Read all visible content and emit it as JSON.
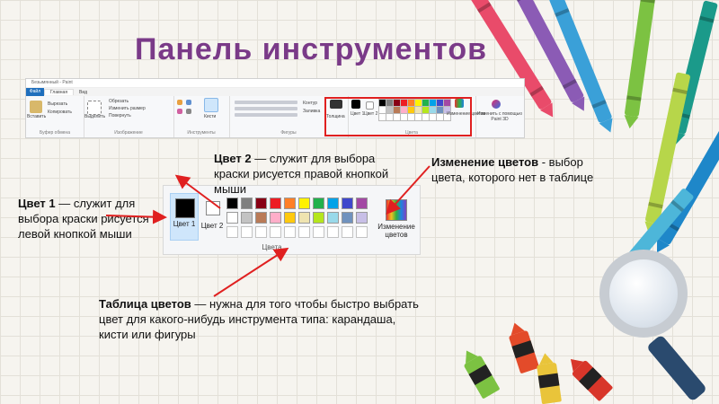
{
  "slide": {
    "title": "Панель инструментов"
  },
  "ribbon": {
    "window_title": "Безымянный - Paint",
    "tabs": [
      "Файл",
      "Главная",
      "Вид"
    ],
    "buttons": {
      "paste": "Вставить",
      "cut": "Вырезать",
      "copy": "Копировать",
      "select": "Выделить",
      "crop": "Обрезать",
      "resize": "Изменить размер",
      "rotate": "Повернуть",
      "brushes": "Кисти",
      "outline": "Контур",
      "fill": "Заливка",
      "thickness": "Толщина",
      "color1": "Цвет 1",
      "color2": "Цвет 2",
      "edit_colors": "Изменение цветов",
      "paint3d": "Изменить с помощью Paint 3D"
    },
    "groups": {
      "clipboard": "Буфер обмена",
      "image": "Изображение",
      "tools": "Инструменты",
      "shapes": "Фигуры",
      "colors": "Цвета"
    }
  },
  "palette": {
    "color1_label": "Цвет 1",
    "color2_label": "Цвет 2",
    "group_label": "Цвета",
    "edit_label": "Изменение цветов",
    "row1": [
      "#000000",
      "#7f7f7f",
      "#880015",
      "#ed1c24",
      "#ff7f27",
      "#fff200",
      "#22b14c",
      "#00a2e8",
      "#3f48cc",
      "#a349a4"
    ],
    "row2": [
      "#ffffff",
      "#c3c3c3",
      "#b97a57",
      "#ffaec9",
      "#ffc90e",
      "#efe4b0",
      "#b5e61d",
      "#99d9ea",
      "#7092be",
      "#c8bfe7"
    ]
  },
  "annotations": {
    "color2": {
      "term": "Цвет 2",
      "text": " — служит для выбора краски рисуется правой кнопкой мыши"
    },
    "color1": {
      "term": "Цвет 1",
      "text": " — служит для выбора краски рисуется левой кнопкой мыши"
    },
    "edit": {
      "term": "Изменение цветов",
      "text": " - выбор цвета, которого нет в таблице"
    },
    "table": {
      "term": "Таблица цветов",
      "text": " — нужна для того чтобы быстро выбрать цвет для какого-нибудь инструмента типа: карандаша, кисти или фигуры"
    }
  },
  "colors": {
    "title": "#7a3a88",
    "arrow": "#e02020"
  }
}
